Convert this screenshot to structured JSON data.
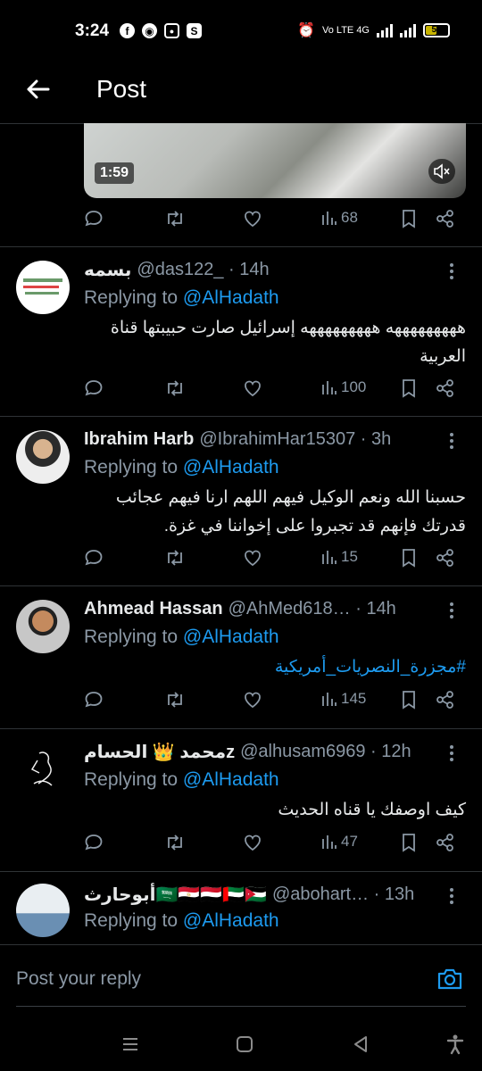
{
  "status_bar": {
    "time": "3:24",
    "left_icons": [
      "facebook-icon",
      "chrome-icon",
      "instagram-icon",
      "s-app-icon"
    ],
    "network": "Vo LTE 4G",
    "battery": "50"
  },
  "header": {
    "title": "Post"
  },
  "video": {
    "duration": "1:59"
  },
  "top_post": {
    "views": "68"
  },
  "replies": [
    {
      "name": "بسمه",
      "handle": "@das122_ · 14h",
      "replying_prefix": "Replying to ",
      "replying_to": "@AlHadath",
      "text": "هههههههههه هههههههههه إسرائيل صارت حبيبتها قناة العربية",
      "views": "100"
    },
    {
      "name": "Ibrahim Harb",
      "handle": "@IbrahimHar15307 · 3h",
      "replying_prefix": "Replying to ",
      "replying_to": "@AlHadath",
      "text": "حسبنا الله ونعم الوكيل فيهم اللهم ارنا فيهم عجائب قدرتك فإنهم قد تجبروا على إخواننا في غزة.",
      "views": "15"
    },
    {
      "name": "Ahmead Hassan",
      "handle": "@AhMed618… · 14h",
      "replying_prefix": "Replying to ",
      "replying_to": "@AlHadath",
      "text": "#مجزرة_النصريات_أمريكية",
      "views": "145"
    },
    {
      "name": "محمد 👑 الحسامz",
      "handle": "@alhusam6969 · 12h",
      "replying_prefix": "Replying to ",
      "replying_to": "@AlHadath",
      "text": "كيف اوصفك يا قناه الحديث",
      "views": "47"
    },
    {
      "name": "أبوحارث🇸🇦🇪🇬🇾🇪🇦🇪🇯🇴",
      "handle": "@abohart… · 13h",
      "replying_prefix": "Replying to ",
      "replying_to": "@AlHadath",
      "text": "",
      "views": ""
    }
  ],
  "composer": {
    "placeholder": "Post your reply"
  },
  "colors": {
    "accent": "#1d9bf0",
    "muted": "#8b98a5",
    "divider": "#2f3336",
    "background": "#000000"
  }
}
